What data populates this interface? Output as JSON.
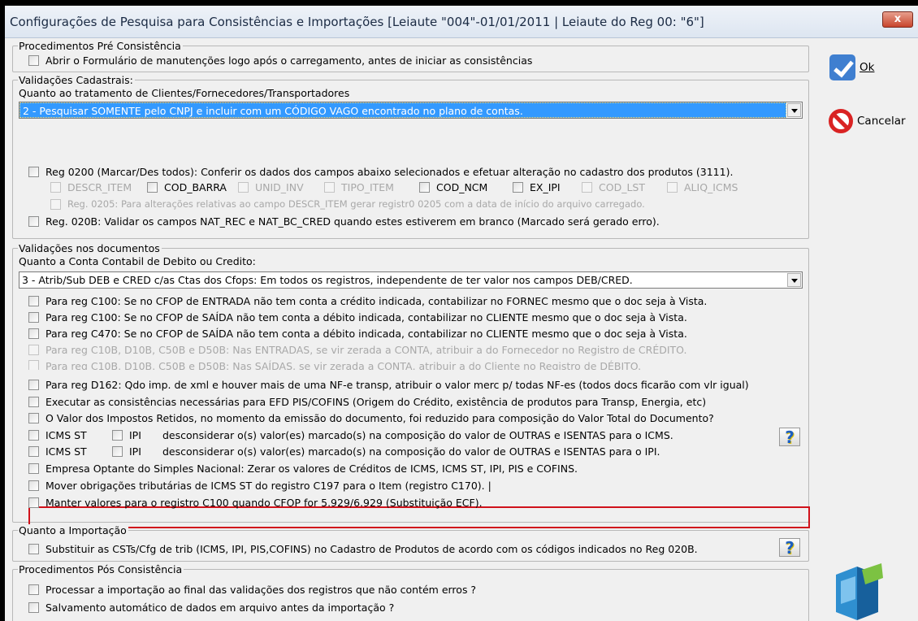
{
  "window": {
    "title": "Configurações de Pesquisa para Consistências e Importações [Leiaute \"004\"-01/01/2011 | Leiaute do Reg 00: \"6\"]",
    "close": "x"
  },
  "pre": {
    "label": "Procedimentos Pré Consistência",
    "items": [
      "Abrir o Formulário de manutenções logo após o carregamento, antes de iniciar as consistências"
    ]
  },
  "cad": {
    "label": "Validações Cadastrais:",
    "sublabel": "Quanto ao tratamento de Clientes/Fornecedores/Transportadores",
    "combo": "2 - Pesquisar SOMENTE pelo CNPJ e incluir com um CÓDIGO VAGO encontrado no plano de contas.",
    "reg0200": "Reg 0200 (Marcar/Des todos): Conferir os dados dos campos abaixo selecionados e efetuar alteração no cadastro dos produtos (3111).",
    "fields": [
      "DESCR_ITEM",
      "COD_BARRA",
      "UNID_INV",
      "TIPO_ITEM",
      "COD_NCM",
      "EX_IPI",
      "COD_LST",
      "ALIQ_ICMS"
    ],
    "reg0205": "Reg. 0205: Para alterações relativas ao campo DESCR_ITEM gerar registr0 0205 com a data de início do arquivo carregado.",
    "reg020b": "Reg. 020B: Validar os campos NAT_REC e NAT_BC_CRED quando estes estiverem em branco (Marcado será gerado erro)."
  },
  "docs": {
    "label": "Validações nos documentos",
    "sublabel": "Quanto a Conta Contabil de Debito ou Credito:",
    "combo": "3 - Atrib/Sub DEB e CRED c/as Ctas dos Cfops: Em todos os registros, independente de ter valor nos campos DEB/CRED.",
    "items": [
      "Para reg C100: Se no CFOP de ENTRADA não tem conta a crédito indicada, contabilizar no FORNEC mesmo que o doc seja à Vista.",
      "Para reg C100: Se no CFOP de SAÍDA não tem conta a débito indicada, contabilizar no CLIENTE mesmo que o doc seja à Vista.",
      "Para reg C470: Se no CFOP de SAÍDA não tem conta a débito indicada, contabilizar no CLIENTE mesmo que o doc seja à Vista.",
      "Para reg C10B, D10B, C50B e D50B: Nas ENTRADAS, se vir zerada a CONTA, atribuir a do Fornecedor no Registro de CRÉDITO.",
      "Para reg C10B, D10B, C50B e D50B: Nas SAÍDAS, se vir zerada a CONTA, atribuir a do Cliente no Registro de DÉBITO.",
      "Para reg D162: Qdo imp. de xml e houver mais de uma NF-e transp, atribuir o valor merc p/ todas NF-es (todos docs ficarão com vlr igual)",
      "Executar as consistências necessárias para EFD PIS/COFINS (Origem do Crédito, existência de produtos para Transp, Energia, etc)",
      "O Valor dos Impostos Retidos, no momento da emissão do documento, foi reduzido para composição do Valor Total do Documento?"
    ],
    "icmsst": "ICMS ST",
    "ipi": "IPI",
    "icms_rule": "desconsiderar o(s) valor(es) marcado(s) na composição do valor de OUTRAS e ISENTAS para o ICMS.",
    "ipi_rule": "desconsiderar o(s) valor(es) marcado(s) na composição do valor de OUTRAS e ISENTAS para o IPI.",
    "items2": [
      "Empresa Optante do Simples Nacional: Zerar os valores de Créditos de ICMS, ICMS ST, IPI, PIS e COFINS.",
      "Mover obrigações tributárias de ICMS ST do registro C197 para o Item (registro C170).  |",
      "Manter valores para o registro C100 quando CFOP for 5.929/6.929 (Substituição ECF)."
    ],
    "help": "?"
  },
  "imp": {
    "label": "Quanto a Importação",
    "item": "Substituir as CSTs/Cfg de trib (ICMS, IPI, PIS,COFINS) no Cadastro de Produtos de acordo com os códigos indicados no Reg 020B.",
    "help": "?"
  },
  "pos": {
    "label": "Procedimentos Pós Consistência",
    "items": [
      "Processar a importação ao final das validações dos registros que não contém erros ?",
      "Salvamento automático de dados em arquivo antes da importação ?"
    ]
  },
  "buttons": {
    "ok": "Ok",
    "cancel": "Cancelar"
  }
}
